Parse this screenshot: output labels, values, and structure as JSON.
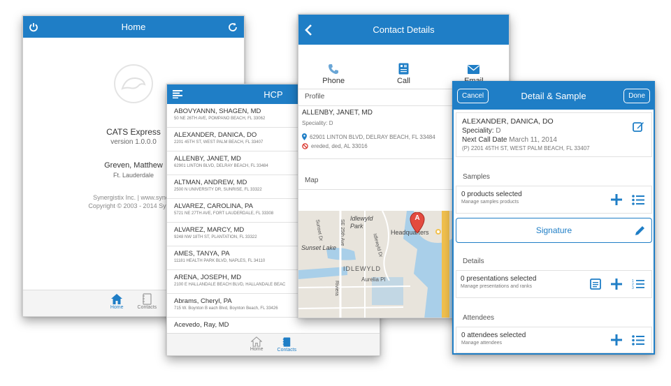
{
  "home": {
    "title": "Home",
    "app_name": "CATS Express",
    "version": "version 1.0.0.0",
    "user": "Greven, Matthew",
    "location": "Ft. Lauderdale",
    "company": "Synergistix Inc. | www.syncm",
    "copyright": "Copyright © 2003 - 2014 Synerg",
    "tabs": {
      "home": "Home",
      "contacts": "Contacts"
    }
  },
  "hcp": {
    "title": "HCP",
    "contacts": [
      {
        "name": "ABOVYANNN, SHAGEN, MD",
        "address": "50 NE 26TH AVE, POMPANO BEACH, FL 33062"
      },
      {
        "name": "ALEXANDER, DANICA, DO",
        "address": "2201 45TH ST, WEST PALM BEACH, FL 33407"
      },
      {
        "name": "ALLENBY, JANET, MD",
        "address": "62901 LINTON BLVD, DELRAY BEACH, FL 33484"
      },
      {
        "name": "ALTMAN, ANDREW, MD",
        "address": "2500 N UNIVERSITY DR, SUNRISE, FL 33322"
      },
      {
        "name": "ALVAREZ, CAROLINA, PA",
        "address": "5721 NE 27TH AVE, FORT LAUDERDALE, FL 33308"
      },
      {
        "name": "ALVAREZ, MARCY, MD",
        "address": "9248 NW 18TH ST, PLANTATION, FL 33322"
      },
      {
        "name": "AMES, TANYA, PA",
        "address": "11181 HEALTH PARK BLVD, NAPLES, FL 34110"
      },
      {
        "name": "ARENA, JOSEPH, MD",
        "address": "2100 E HALLANDALE BEACH BLVD, HALLANDALE BEAC"
      },
      {
        "name": "Abrams, Cheryl, PA",
        "address": "715 W. Boynton B each Blvd, Boynton Beach, FL 33426"
      },
      {
        "name": "Acevedo, Ray, MD",
        "address": ""
      }
    ],
    "tabs": {
      "home": "Home",
      "contacts": "Contacts"
    }
  },
  "contact": {
    "title": "Contact Details",
    "actions": {
      "phone": "Phone",
      "call": "Call",
      "email": "Email"
    },
    "profile_label": "Profile",
    "name": "ALLENBY, JANET, MD",
    "speciality_label": "Speciality:",
    "speciality_value": "D",
    "address": "62901 LINTON BLVD, DELRAY BEACH, FL 33484",
    "address_bad": "ereded, ded, AL 33016",
    "map_label": "Map",
    "map_text": {
      "idlewyld_park": "Idlewyld Park",
      "headquarters": "Headquarters",
      "sunset_dr": "Sunset Dr",
      "se_25th_ave": "SE 25th Ave",
      "sunset_lake": "Sunset Lake",
      "idlewyld": "IDLEWYLD",
      "aurelia": "Aurelia Pl",
      "riviera": "Riviera",
      "idlewyld_dr": "Idlewyld Dr",
      "marker": "A"
    }
  },
  "detail": {
    "title": "Detail & Sample",
    "cancel": "Cancel",
    "done": "Done",
    "name": "ALEXANDER, DANICA, DO",
    "speciality_label": "Speciality:",
    "speciality_value": "D",
    "next_call_label": "Next Call Date",
    "next_call_value": "March 11, 2014",
    "address": "(P) 2201 45TH ST, WEST PALM BEACH, FL 33407",
    "samples": {
      "label": "Samples",
      "main": "0 products selected",
      "sub": "Manage samples products"
    },
    "signature": "Signature",
    "details": {
      "label": "Details",
      "main": "0 presentations selected",
      "sub": "Manage presentations and ranks"
    },
    "attendees": {
      "label": "Attendees",
      "main": "0 attendees selected",
      "sub": "Manage attendees"
    }
  },
  "colors": {
    "accent": "#1f7ec6",
    "error": "#d9342b"
  }
}
